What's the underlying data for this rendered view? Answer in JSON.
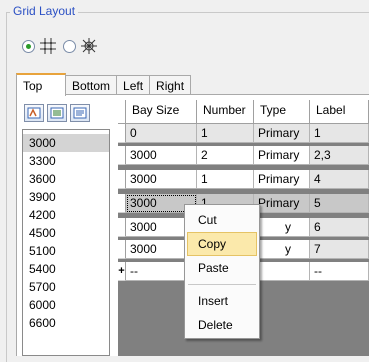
{
  "group": {
    "title": "Grid Layout"
  },
  "radios": [
    {
      "icon": "grid-icon",
      "checked": true
    },
    {
      "icon": "radial-grid-icon",
      "checked": false
    }
  ],
  "tabs": [
    {
      "label": "Top",
      "active": true
    },
    {
      "label": "Bottom",
      "active": false
    },
    {
      "label": "Left",
      "active": false
    },
    {
      "label": "Right",
      "active": false
    }
  ],
  "toolbar": {
    "icons": [
      "sort-icon",
      "import-icon",
      "export-icon"
    ]
  },
  "list": {
    "selected": "3000",
    "items": [
      "3000",
      "3300",
      "3600",
      "3900",
      "4200",
      "4500",
      "5100",
      "5400",
      "5700",
      "6000",
      "6600"
    ]
  },
  "grid": {
    "headers": [
      "Bay Size",
      "Number",
      "Type",
      "Label"
    ],
    "rows": [
      {
        "cells": [
          "0",
          "1",
          "Primary",
          "1"
        ]
      },
      {
        "cells": [
          "3000",
          "2",
          "Primary",
          "2,3"
        ]
      },
      {
        "cells": [
          "3000",
          "1",
          "Primary",
          "4"
        ]
      },
      {
        "cells": [
          "3000",
          "1",
          "Primary",
          "5"
        ],
        "selected": true
      },
      {
        "cells": [
          "3000",
          "",
          "y",
          "6"
        ]
      },
      {
        "cells": [
          "3000",
          "",
          "y",
          "7"
        ]
      },
      {
        "cells": [
          "--",
          "",
          "",
          "--"
        ],
        "new_row": true
      }
    ],
    "new_row_marker": "+"
  },
  "context_menu": {
    "items": [
      "Cut",
      "Copy",
      "Paste",
      "Insert",
      "Delete"
    ],
    "hovered": "Copy"
  }
}
